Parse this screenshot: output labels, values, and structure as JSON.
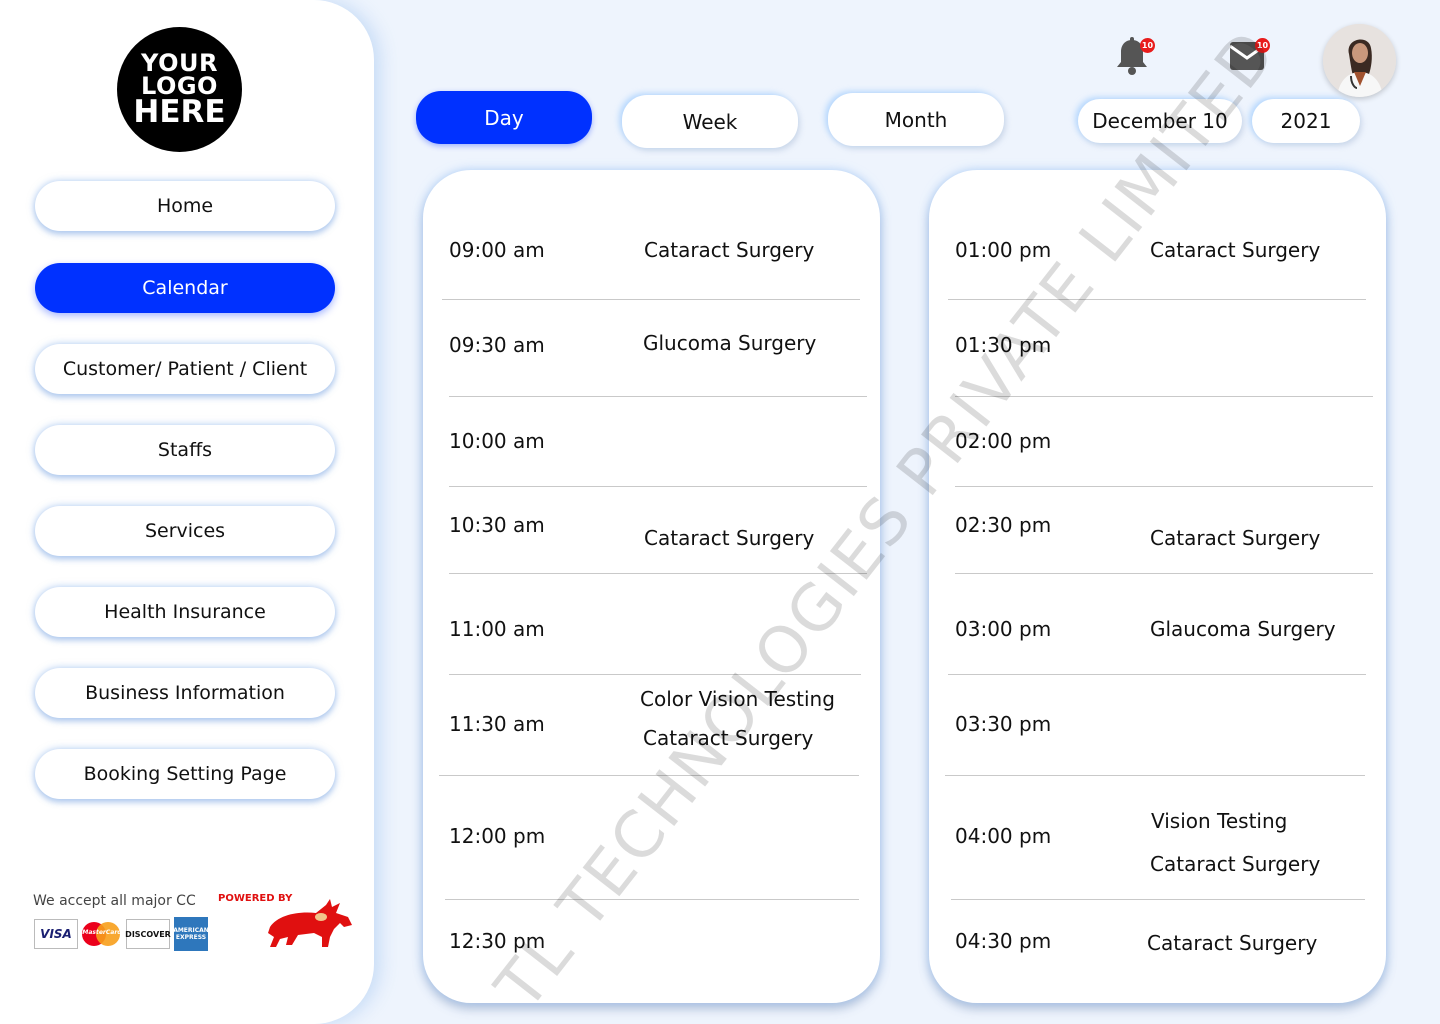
{
  "logo": {
    "line1": "YOUR",
    "line2": "LOGO",
    "line3": "HERE"
  },
  "sidebar": {
    "items": [
      {
        "label": "Home"
      },
      {
        "label": "Calendar"
      },
      {
        "label": "Customer/ Patient / Client"
      },
      {
        "label": "Staffs"
      },
      {
        "label": "Services"
      },
      {
        "label": "Health Insurance"
      },
      {
        "label": "Business Information"
      },
      {
        "label": "Booking Setting Page"
      }
    ],
    "active_item": "Calendar",
    "cc_text": "We accept all major CC",
    "cards": [
      "VISA",
      "MasterCard",
      "DISCOVER",
      "AMERICAN EXPRESS"
    ],
    "powered_by": "POWERED BY"
  },
  "topbar": {
    "notifications_count": "10",
    "messages_count": "10"
  },
  "view_tabs": [
    {
      "label": "Day"
    },
    {
      "label": "Week"
    },
    {
      "label": "Month"
    }
  ],
  "active_view": "Day",
  "date": {
    "day": "December 10",
    "year": "2021"
  },
  "schedule_left": [
    {
      "time": "09:00 am",
      "events": [
        "Cataract Surgery"
      ]
    },
    {
      "time": "09:30 am",
      "events": [
        "Glucoma Surgery"
      ]
    },
    {
      "time": "10:00 am",
      "events": []
    },
    {
      "time": "10:30 am",
      "events": [
        "Cataract Surgery"
      ]
    },
    {
      "time": "11:00 am",
      "events": []
    },
    {
      "time": "11:30 am",
      "events": [
        "Color Vision Testing",
        "Cataract Surgery"
      ]
    },
    {
      "time": "12:00 pm",
      "events": []
    },
    {
      "time": "12:30 pm",
      "events": []
    }
  ],
  "schedule_right": [
    {
      "time": "01:00 pm",
      "events": [
        "Cataract Surgery"
      ]
    },
    {
      "time": "01:30 pm",
      "events": []
    },
    {
      "time": "02:00 pm",
      "events": []
    },
    {
      "time": "02:30 pm",
      "events": [
        "Cataract Surgery"
      ]
    },
    {
      "time": "03:00 pm",
      "events": [
        "Glaucoma Surgery"
      ]
    },
    {
      "time": "03:30 pm",
      "events": []
    },
    {
      "time": "04:00 pm",
      "events": [
        "Vision Testing",
        "Cataract Surgery"
      ]
    },
    {
      "time": "04:30 pm",
      "events": [
        "Cataract Surgery"
      ]
    }
  ],
  "watermark": "TL TECHNOLOGIES PRIVATE LIMITED",
  "colors": {
    "accent": "#0031ff",
    "background": "#eef4fd",
    "badge": "#e81c1c"
  }
}
